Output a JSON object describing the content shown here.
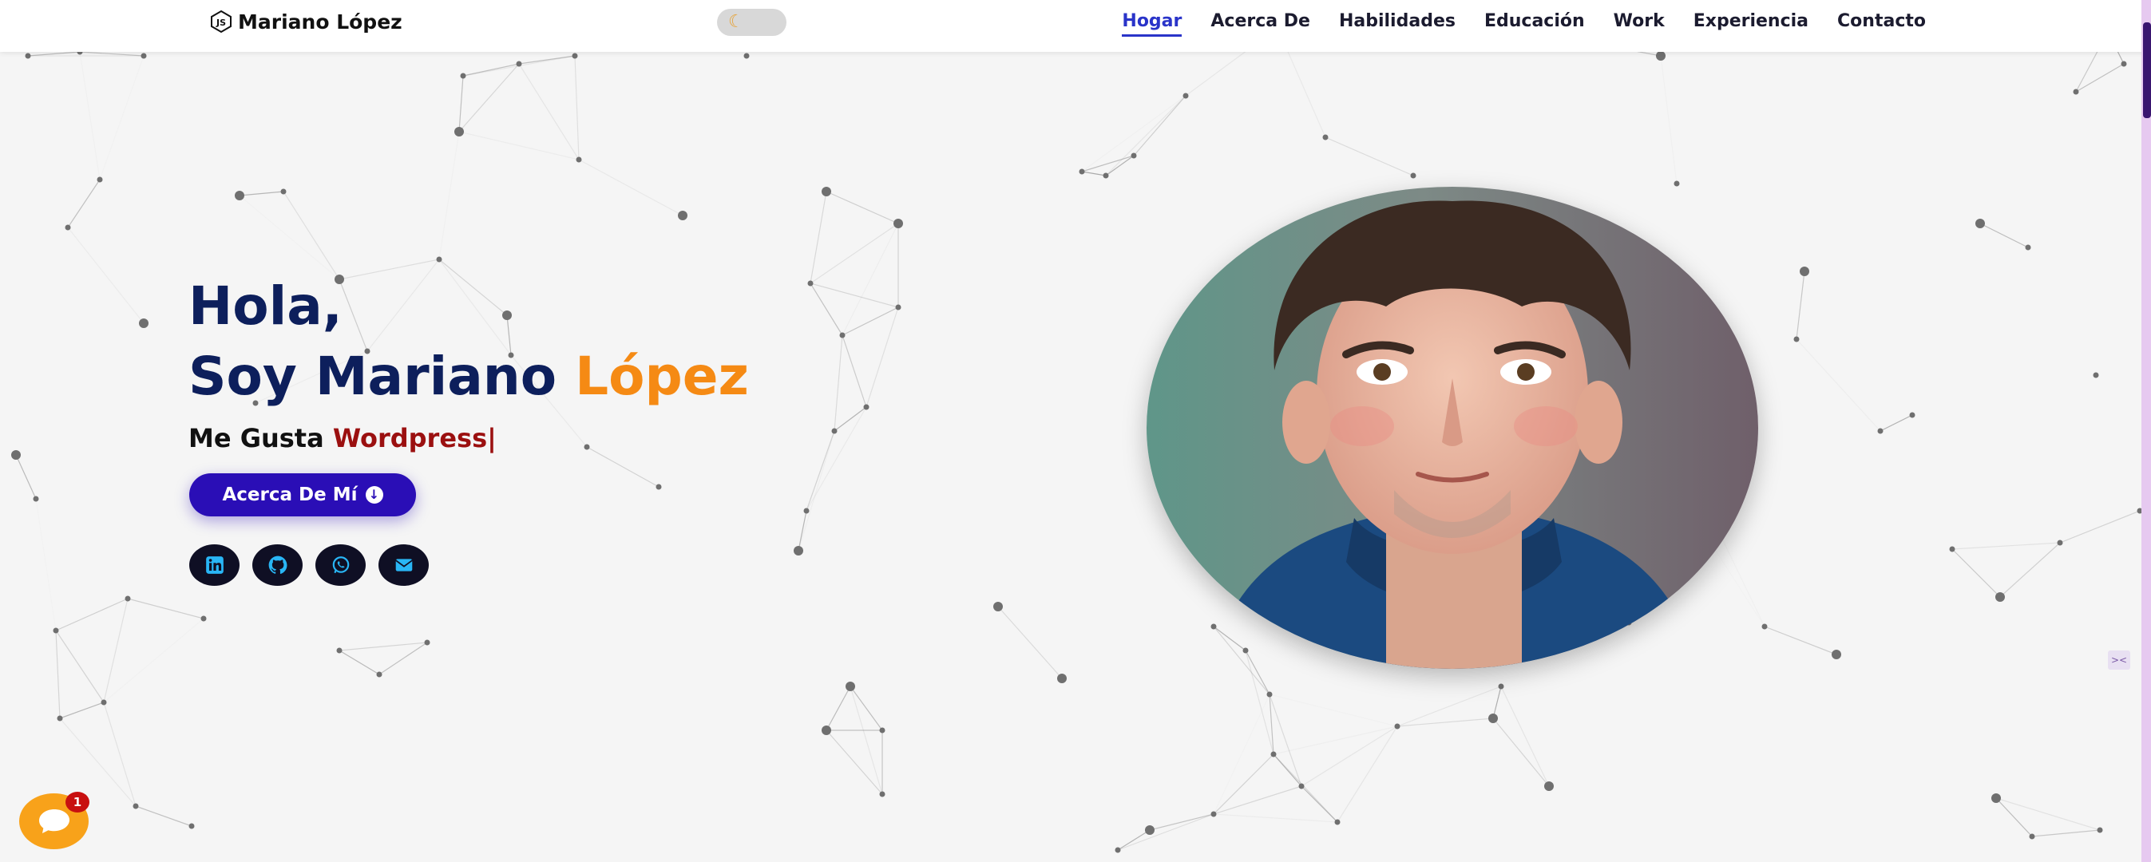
{
  "brand": {
    "name": "Mariano López",
    "logo_icon": "hexagon-js-logo-icon"
  },
  "theme_toggle": {
    "icon": "moon-icon",
    "accent": "#e7a43a"
  },
  "nav": {
    "items": [
      {
        "label": "Hogar",
        "active": true
      },
      {
        "label": "Acerca De",
        "active": false
      },
      {
        "label": "Habilidades",
        "active": false
      },
      {
        "label": "Educación",
        "active": false
      },
      {
        "label": "Work",
        "active": false
      },
      {
        "label": "Experiencia",
        "active": false
      },
      {
        "label": "Contacto",
        "active": false
      }
    ],
    "active_color": "#2a34c9"
  },
  "hero": {
    "greeting": "Hola,",
    "name_prefix": "Soy Mariano",
    "name_last": "López",
    "tagline_prefix": "Me Gusta",
    "tagline_skill": "Wordpress",
    "cursor": "|",
    "button_label": "Acerca De Mí",
    "button_icon": "arrow-down-circle-icon"
  },
  "socials": [
    {
      "name": "linkedin",
      "icon": "linkedin-icon"
    },
    {
      "name": "github",
      "icon": "github-icon"
    },
    {
      "name": "whatsapp",
      "icon": "whatsapp-icon"
    },
    {
      "name": "email",
      "icon": "envelope-icon"
    }
  ],
  "chat": {
    "badge": "1",
    "icon": "chat-bubble-icon"
  },
  "colors": {
    "heading": "#0d1f5c",
    "accent_orange": "#f58a14",
    "skill_red": "#9b1010",
    "button": "#2a0eb6",
    "social_icon": "#29b6f6"
  }
}
